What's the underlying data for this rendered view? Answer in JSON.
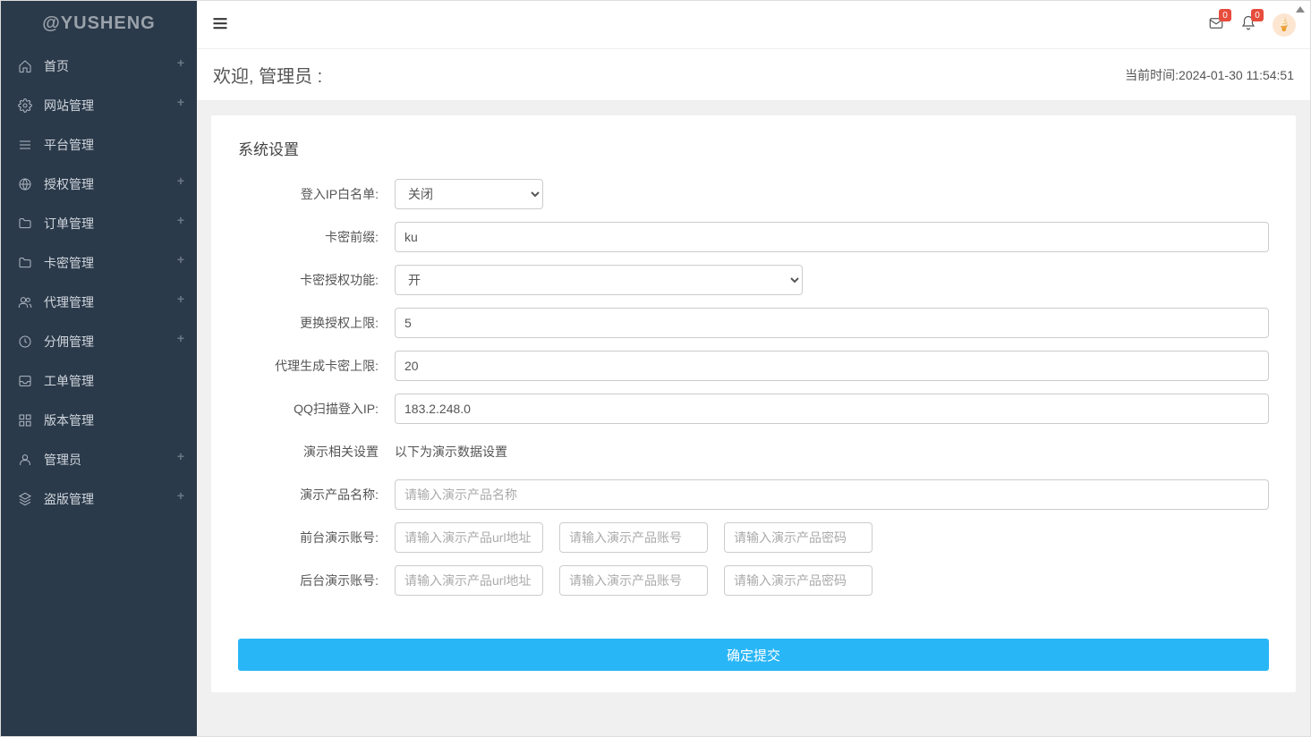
{
  "brand": "@YUSHENG",
  "sidebar": {
    "items": [
      {
        "label": "首页",
        "icon": "home",
        "plus": true
      },
      {
        "label": "网站管理",
        "icon": "gear",
        "plus": true
      },
      {
        "label": "平台管理",
        "icon": "menu",
        "plus": false
      },
      {
        "label": "授权管理",
        "icon": "globe",
        "plus": true
      },
      {
        "label": "订单管理",
        "icon": "folder",
        "plus": true
      },
      {
        "label": "卡密管理",
        "icon": "folder",
        "plus": true
      },
      {
        "label": "代理管理",
        "icon": "users",
        "plus": true
      },
      {
        "label": "分佣管理",
        "icon": "clock",
        "plus": true
      },
      {
        "label": "工单管理",
        "icon": "inbox",
        "plus": false
      },
      {
        "label": "版本管理",
        "icon": "grid",
        "plus": false
      },
      {
        "label": "管理员",
        "icon": "user",
        "plus": true
      },
      {
        "label": "盗版管理",
        "icon": "layers",
        "plus": true
      }
    ]
  },
  "topbar": {
    "mail_badge": "0",
    "bell_badge": "0"
  },
  "welcome": {
    "text": "欢迎, 管理员 :",
    "time": "当前时间:2024-01-30 11:54:51"
  },
  "panel": {
    "title": "系统设置",
    "labels": {
      "ip_whitelist": "登入IP白名单:",
      "card_prefix": "卡密前缀:",
      "card_auth": "卡密授权功能:",
      "change_limit": "更换授权上限:",
      "agent_card_limit": "代理生成卡密上限:",
      "qq_ip": "QQ扫描登入IP:",
      "demo_section": "演示相关设置",
      "demo_section_note": "以下为演示数据设置",
      "demo_product": "演示产品名称:",
      "front_demo": "前台演示账号:",
      "back_demo": "后台演示账号:"
    },
    "values": {
      "ip_whitelist": "关闭",
      "card_prefix": "ku",
      "card_auth": "开",
      "change_limit": "5",
      "agent_card_limit": "20",
      "qq_ip": "183.2.248.0"
    },
    "placeholders": {
      "demo_product": "请输入演示产品名称",
      "demo_url": "请输入演示产品url地址",
      "demo_account": "请输入演示产品账号",
      "demo_password": "请输入演示产品密码"
    },
    "submit_label": "确定提交"
  }
}
